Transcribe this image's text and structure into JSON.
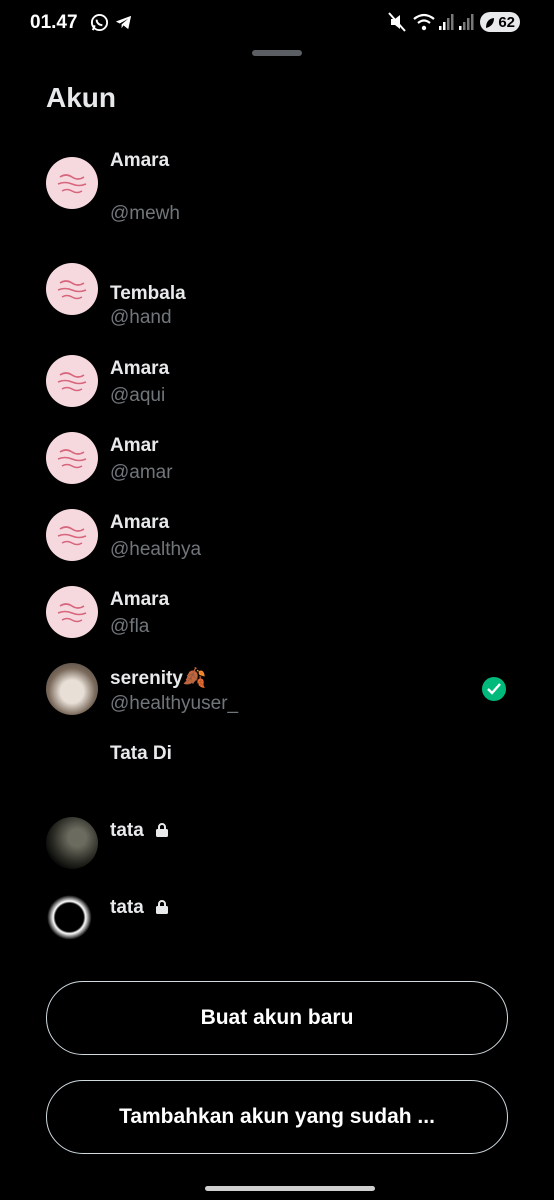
{
  "status_bar": {
    "time": "01.47",
    "icons": [
      "whatsapp-icon",
      "telegram-icon",
      "mute-icon",
      "wifi-icon",
      "signal-icon",
      "signal-icon-2"
    ],
    "battery": "62"
  },
  "sheet": {
    "title": "Akun"
  },
  "accounts": [
    {
      "name": "Amara",
      "handle": "@mewh",
      "avatar": "pink-quote"
    },
    {
      "name": "Tembala",
      "handle": "@hand",
      "avatar": "pink-quote"
    },
    {
      "name": "Amara",
      "handle": "@aqui",
      "avatar": "pink-quote"
    },
    {
      "name": "Amar",
      "handle": "@amar",
      "avatar": "pink-quote"
    },
    {
      "name": "Amara",
      "handle": "@healthya",
      "avatar": "pink-quote"
    },
    {
      "name": "Amara",
      "handle": "@fla",
      "avatar": "pink-quote"
    },
    {
      "name": "serenity🍂",
      "handle": "@healthyuser_",
      "avatar": "kitten",
      "active": true
    },
    {
      "name": "Tata Di",
      "handle": "",
      "avatar": "none"
    },
    {
      "name": "tata",
      "handle": "",
      "avatar": "dark",
      "locked": true
    },
    {
      "name": "tata",
      "handle": "",
      "avatar": "bw",
      "locked": true
    }
  ],
  "buttons": {
    "create": "Buat akun baru",
    "add_existing": "Tambahkan akun yang sudah ..."
  },
  "colors": {
    "background": "#000000",
    "primary_text": "#e7e9ea",
    "secondary_text": "#71767b",
    "check": "#00ba7c"
  }
}
